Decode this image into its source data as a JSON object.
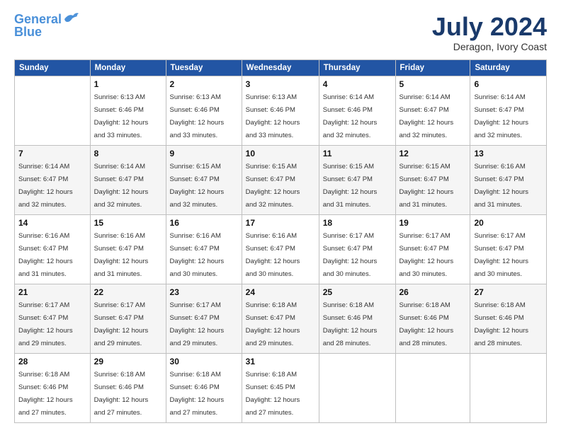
{
  "logo": {
    "line1": "General",
    "line2": "Blue"
  },
  "title": "July 2024",
  "location": "Deragon, Ivory Coast",
  "weekdays": [
    "Sunday",
    "Monday",
    "Tuesday",
    "Wednesday",
    "Thursday",
    "Friday",
    "Saturday"
  ],
  "weeks": [
    [
      null,
      {
        "d": "1",
        "sr": "6:13 AM",
        "ss": "6:46 PM",
        "dl": "12 hours and 33 minutes."
      },
      {
        "d": "2",
        "sr": "6:13 AM",
        "ss": "6:46 PM",
        "dl": "12 hours and 33 minutes."
      },
      {
        "d": "3",
        "sr": "6:13 AM",
        "ss": "6:46 PM",
        "dl": "12 hours and 33 minutes."
      },
      {
        "d": "4",
        "sr": "6:14 AM",
        "ss": "6:46 PM",
        "dl": "12 hours and 32 minutes."
      },
      {
        "d": "5",
        "sr": "6:14 AM",
        "ss": "6:47 PM",
        "dl": "12 hours and 32 minutes."
      },
      {
        "d": "6",
        "sr": "6:14 AM",
        "ss": "6:47 PM",
        "dl": "12 hours and 32 minutes."
      }
    ],
    [
      {
        "d": "7",
        "sr": "6:14 AM",
        "ss": "6:47 PM",
        "dl": "12 hours and 32 minutes."
      },
      {
        "d": "8",
        "sr": "6:14 AM",
        "ss": "6:47 PM",
        "dl": "12 hours and 32 minutes."
      },
      {
        "d": "9",
        "sr": "6:15 AM",
        "ss": "6:47 PM",
        "dl": "12 hours and 32 minutes."
      },
      {
        "d": "10",
        "sr": "6:15 AM",
        "ss": "6:47 PM",
        "dl": "12 hours and 32 minutes."
      },
      {
        "d": "11",
        "sr": "6:15 AM",
        "ss": "6:47 PM",
        "dl": "12 hours and 31 minutes."
      },
      {
        "d": "12",
        "sr": "6:15 AM",
        "ss": "6:47 PM",
        "dl": "12 hours and 31 minutes."
      },
      {
        "d": "13",
        "sr": "6:16 AM",
        "ss": "6:47 PM",
        "dl": "12 hours and 31 minutes."
      }
    ],
    [
      {
        "d": "14",
        "sr": "6:16 AM",
        "ss": "6:47 PM",
        "dl": "12 hours and 31 minutes."
      },
      {
        "d": "15",
        "sr": "6:16 AM",
        "ss": "6:47 PM",
        "dl": "12 hours and 31 minutes."
      },
      {
        "d": "16",
        "sr": "6:16 AM",
        "ss": "6:47 PM",
        "dl": "12 hours and 30 minutes."
      },
      {
        "d": "17",
        "sr": "6:16 AM",
        "ss": "6:47 PM",
        "dl": "12 hours and 30 minutes."
      },
      {
        "d": "18",
        "sr": "6:17 AM",
        "ss": "6:47 PM",
        "dl": "12 hours and 30 minutes."
      },
      {
        "d": "19",
        "sr": "6:17 AM",
        "ss": "6:47 PM",
        "dl": "12 hours and 30 minutes."
      },
      {
        "d": "20",
        "sr": "6:17 AM",
        "ss": "6:47 PM",
        "dl": "12 hours and 30 minutes."
      }
    ],
    [
      {
        "d": "21",
        "sr": "6:17 AM",
        "ss": "6:47 PM",
        "dl": "12 hours and 29 minutes."
      },
      {
        "d": "22",
        "sr": "6:17 AM",
        "ss": "6:47 PM",
        "dl": "12 hours and 29 minutes."
      },
      {
        "d": "23",
        "sr": "6:17 AM",
        "ss": "6:47 PM",
        "dl": "12 hours and 29 minutes."
      },
      {
        "d": "24",
        "sr": "6:18 AM",
        "ss": "6:47 PM",
        "dl": "12 hours and 29 minutes."
      },
      {
        "d": "25",
        "sr": "6:18 AM",
        "ss": "6:46 PM",
        "dl": "12 hours and 28 minutes."
      },
      {
        "d": "26",
        "sr": "6:18 AM",
        "ss": "6:46 PM",
        "dl": "12 hours and 28 minutes."
      },
      {
        "d": "27",
        "sr": "6:18 AM",
        "ss": "6:46 PM",
        "dl": "12 hours and 28 minutes."
      }
    ],
    [
      {
        "d": "28",
        "sr": "6:18 AM",
        "ss": "6:46 PM",
        "dl": "12 hours and 27 minutes."
      },
      {
        "d": "29",
        "sr": "6:18 AM",
        "ss": "6:46 PM",
        "dl": "12 hours and 27 minutes."
      },
      {
        "d": "30",
        "sr": "6:18 AM",
        "ss": "6:46 PM",
        "dl": "12 hours and 27 minutes."
      },
      {
        "d": "31",
        "sr": "6:18 AM",
        "ss": "6:45 PM",
        "dl": "12 hours and 27 minutes."
      },
      null,
      null,
      null
    ]
  ],
  "labels": {
    "sunrise": "Sunrise:",
    "sunset": "Sunset:",
    "daylight": "Daylight:"
  }
}
